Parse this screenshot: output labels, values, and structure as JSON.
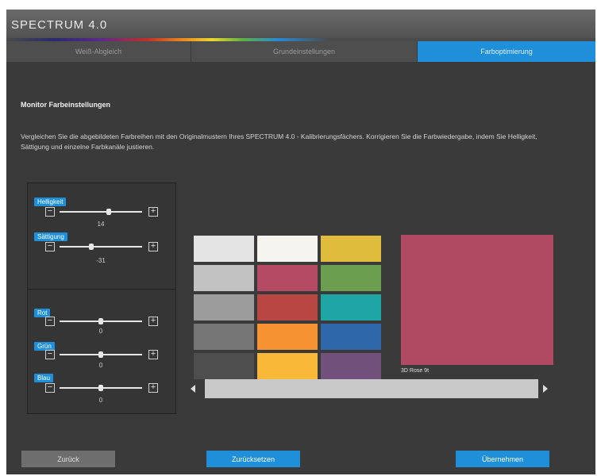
{
  "app": {
    "title": "SPECTRUM 4.0"
  },
  "tabs": [
    {
      "label": "Weiß-Abgleich",
      "active": false
    },
    {
      "label": "Grundeinstellungen",
      "active": false
    },
    {
      "label": "Farboptimierung",
      "active": true
    }
  ],
  "section": {
    "title": "Monitor Farbeinstellungen",
    "description": "Vergleichen Sie die abgebildeten Farbreihen mit den Originalmustern Ihres SPECTRUM 4.0 - Kalibrierungsfächers. Korrigieren Sie die Farbwiedergabe, indem Sie Helligkeit, Sättigung und einzelne Farbkanäle justieren."
  },
  "sliders": {
    "helligkeit": {
      "label": "Helligkeit",
      "value": "14",
      "level": 0.6
    },
    "saettigung": {
      "label": "Sättigung",
      "value": "-31",
      "level": 0.38
    },
    "rot": {
      "label": "Rot",
      "value": "0",
      "level": 0.5
    },
    "gruen": {
      "label": "Grün",
      "value": "0",
      "level": 0.5
    },
    "blau": {
      "label": "Blau",
      "value": "0",
      "level": 0.5
    }
  },
  "swatches": {
    "col1": [
      "#e4e4e4",
      "#c2c2c2",
      "#9c9c9c",
      "#767676",
      "#4e4e4e"
    ],
    "col2": [
      "#f6f4ee",
      "#b54a64",
      "#b84642",
      "#f59232",
      "#f8b838"
    ],
    "col3": [
      "#e0bc3c",
      "#6c9e50",
      "#1ea6a4",
      "#2e68a8",
      "#72507c"
    ]
  },
  "preview": {
    "color": "#b04a62",
    "label": "3D Rose 9t"
  },
  "buttons": {
    "back": "Zurück",
    "reset": "Zurücksetzen",
    "apply": "Übernehmen"
  },
  "colors": {
    "accent": "#1e8fd8",
    "background": "#3a3a3a"
  }
}
